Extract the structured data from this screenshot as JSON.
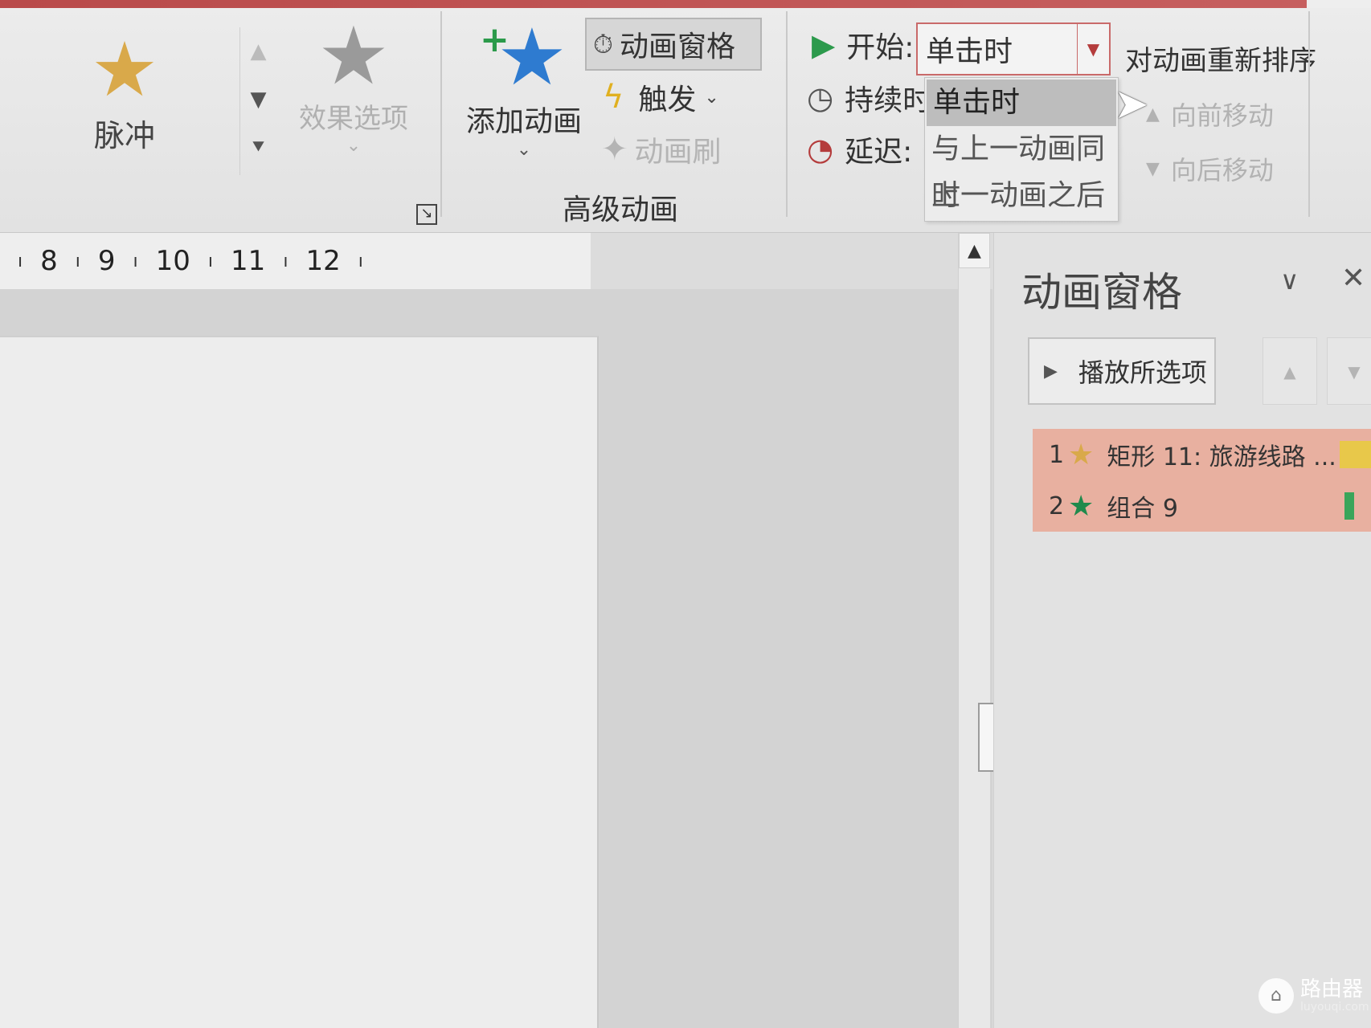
{
  "ribbon": {
    "effect_gallery": {
      "current_effect": "脉冲",
      "current_icon": "star-gold-icon",
      "scroll_up": "▲",
      "scroll_down": "▼",
      "more": "⯆"
    },
    "effect_options": {
      "label": "效果选项",
      "icon": "star-gray-icon",
      "chevron": "⌄",
      "enabled": false
    },
    "advanced": {
      "group_label": "高级动画",
      "add_animation": {
        "label": "添加动画",
        "chevron": "⌄"
      },
      "animation_pane_button": {
        "label": "动画窗格",
        "state": "pressed"
      },
      "trigger": {
        "label": "触发",
        "chevron": "⌄"
      },
      "animation_painter": {
        "label": "动画刷",
        "enabled": false
      }
    },
    "timing": {
      "start_label": "开始:",
      "start_value": "单击时",
      "duration_label": "持续时",
      "delay_label": "延迟:",
      "dropdown_options": [
        {
          "label": "单击时",
          "selected": true
        },
        {
          "label": "与上一动画同时",
          "selected": false
        },
        {
          "label": "上一动画之后",
          "selected": false
        }
      ]
    },
    "reorder": {
      "title": "对动画重新排序",
      "move_earlier": "向前移动",
      "move_later": "向后移动"
    }
  },
  "ruler": {
    "numbers": [
      "8",
      "9",
      "10",
      "11",
      "12"
    ]
  },
  "animation_pane": {
    "title": "动画窗格",
    "play_button": "播放所选项",
    "items": [
      {
        "number": "1",
        "icon": "star-gold-icon",
        "label": "矩形 11: 旅游线路 ...",
        "star_color": "#d9a94a",
        "bar_color": "#e8c84a"
      },
      {
        "number": "2",
        "icon": "star-green-icon",
        "label": "组合 9",
        "star_color": "#1f8a4c",
        "bar_color": "#3aa55a"
      }
    ]
  },
  "watermark": {
    "name": "路由器",
    "site": "luyouqi.com"
  },
  "colors": {
    "accent_red": "#c96a6a",
    "selected_row": "#e8b0a0",
    "ribbon_bg": "#e6e6e6"
  }
}
